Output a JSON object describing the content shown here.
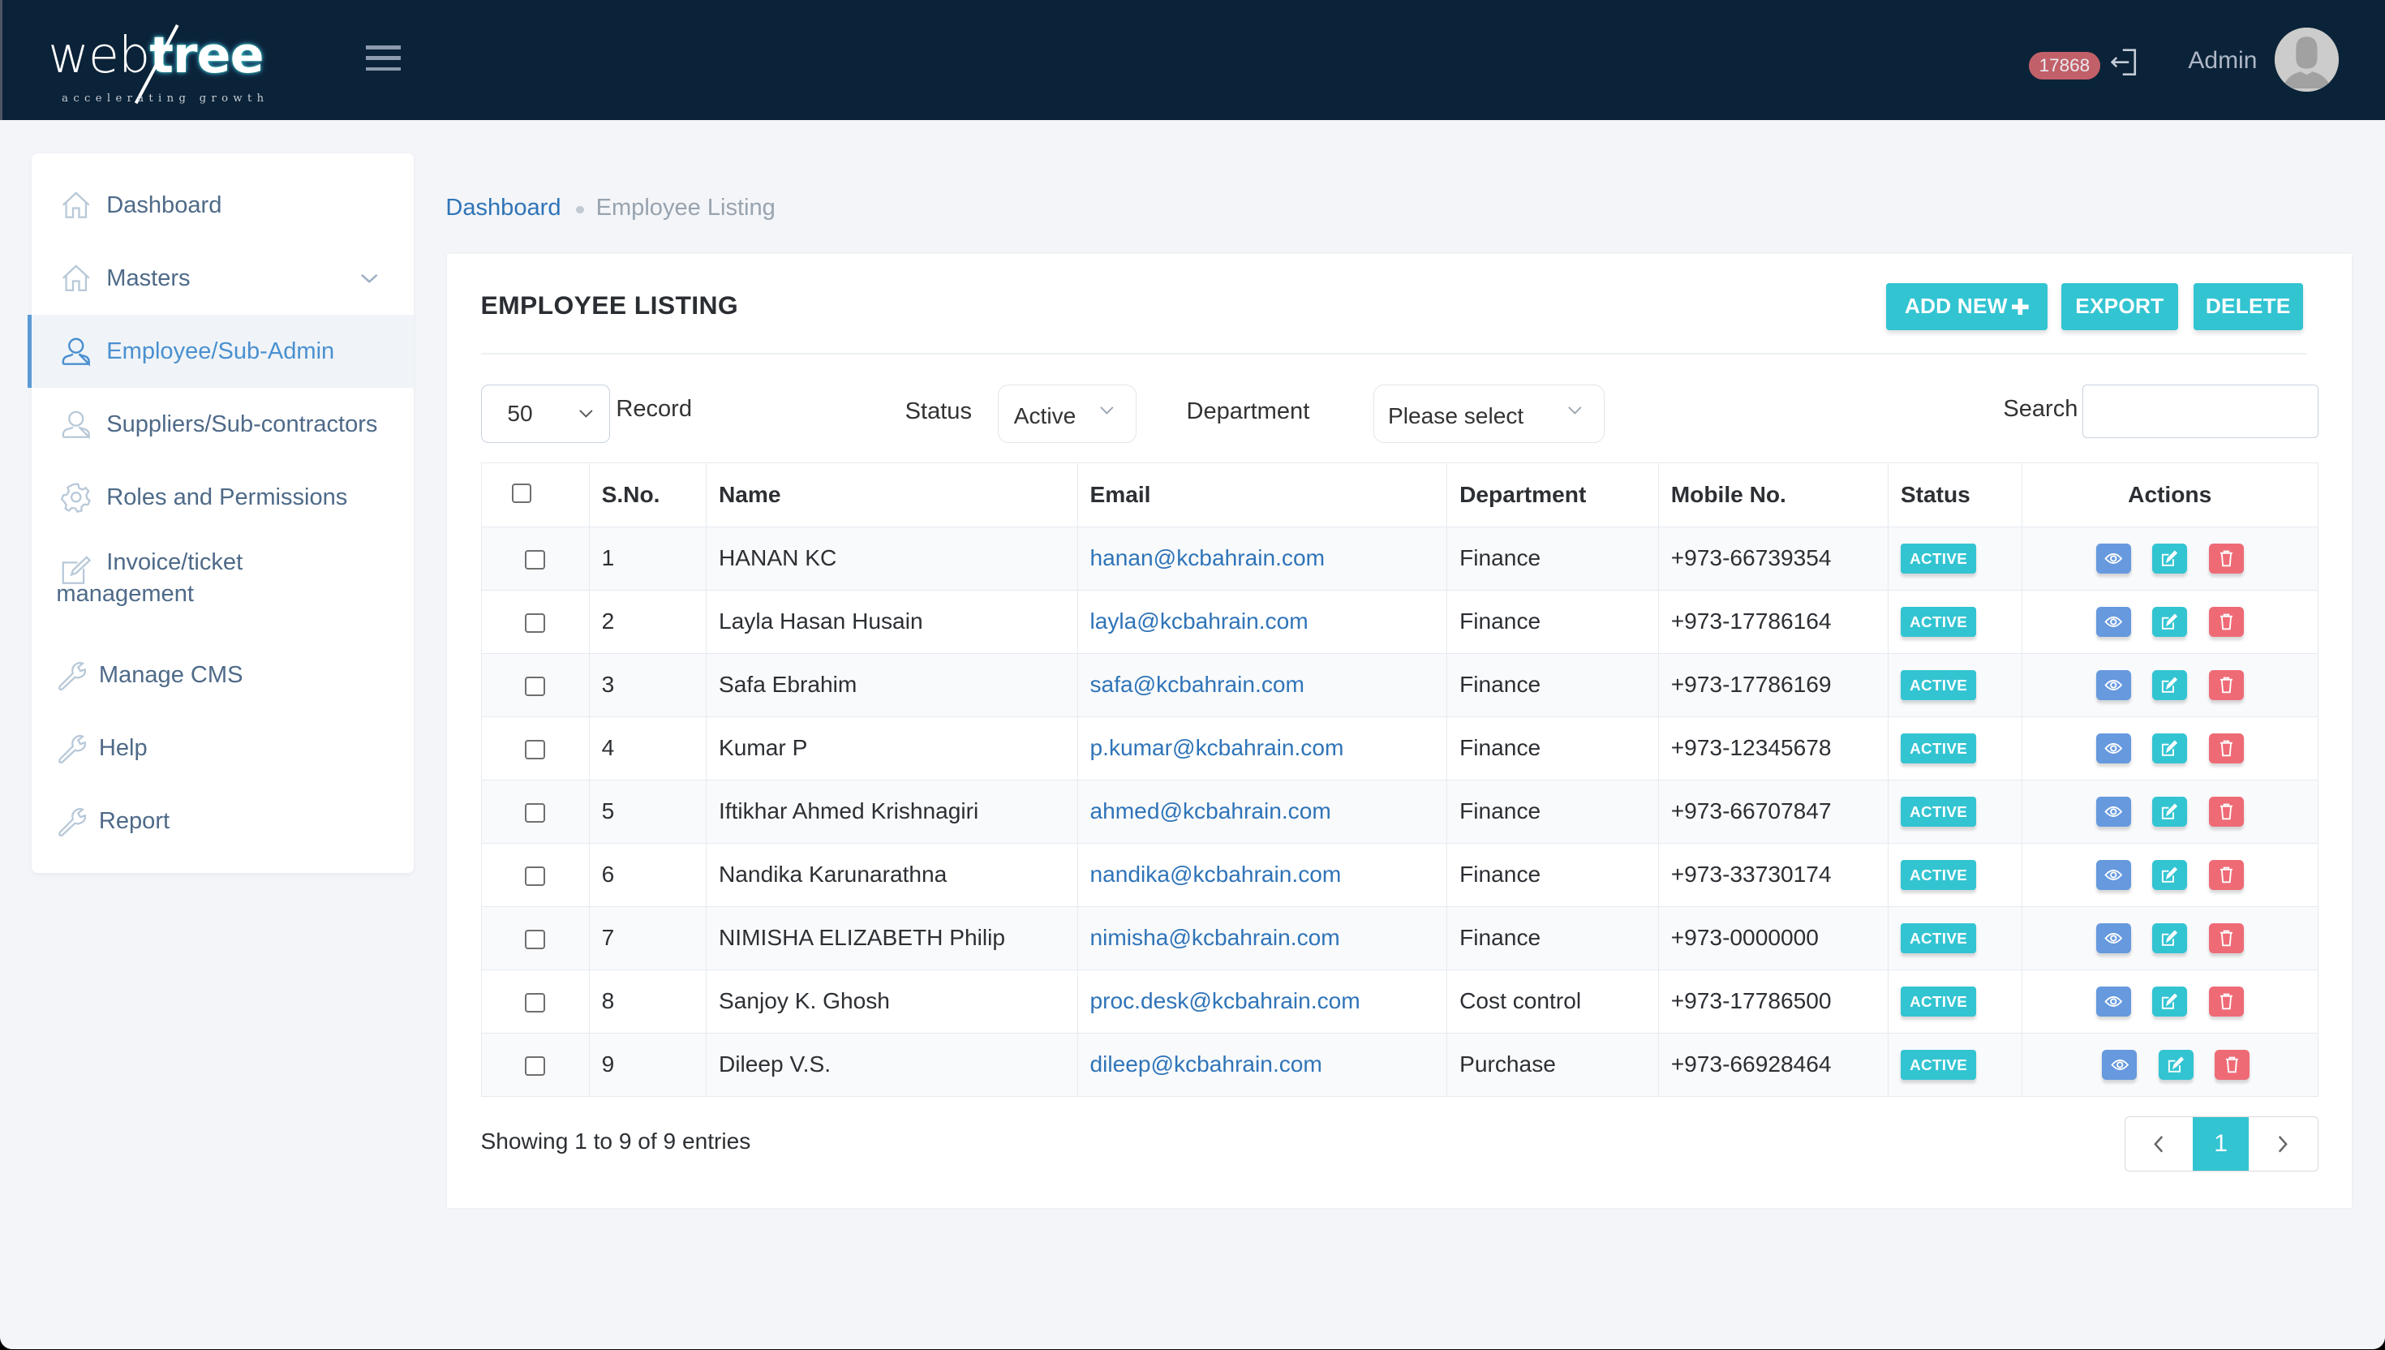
{
  "header": {
    "logo": {
      "word_a": "web",
      "word_b": "tree",
      "tagline": "accelerating growth"
    },
    "notification_count": "17868",
    "user_name": "Admin",
    "icons": {
      "menu": "hamburger-icon",
      "logout": "logout-icon",
      "avatar": "user-avatar-icon"
    }
  },
  "sidebar": {
    "items": [
      {
        "label": "Dashboard",
        "icon": "home-icon",
        "active": false
      },
      {
        "label": "Masters",
        "icon": "home-icon",
        "active": false,
        "has_submenu": true
      },
      {
        "label": "Employee/Sub-Admin",
        "icon": "user-icon",
        "active": true
      },
      {
        "label": "Suppliers/Sub-contractors",
        "icon": "user-icon",
        "active": false
      },
      {
        "label": "Roles and Permissions",
        "icon": "gear-icon",
        "active": false
      },
      {
        "label_line1": "Invoice/ticket",
        "label_line2": "management",
        "icon": "edit-icon",
        "active": false
      },
      {
        "label": "Manage CMS",
        "icon": "wrench-icon",
        "active": false
      },
      {
        "label": "Help",
        "icon": "wrench-icon",
        "active": false
      },
      {
        "label": "Report",
        "icon": "wrench-icon",
        "active": false
      }
    ]
  },
  "breadcrumb": {
    "home": "Dashboard",
    "current": "Employee Listing"
  },
  "card": {
    "title": "EMPLOYEE LISTING",
    "buttons": {
      "add_new": "ADD NEW",
      "export": "EXPORT",
      "delete": "DELETE"
    }
  },
  "filters": {
    "records_value": "50",
    "records_label": "Record",
    "status_label": "Status",
    "status_value": "Active",
    "department_label": "Department",
    "department_value": "Please select",
    "search_label": "Search",
    "search_value": ""
  },
  "table": {
    "columns": [
      "S.No.",
      "Name",
      "Email",
      "Department",
      "Mobile No.",
      "Status",
      "Actions"
    ],
    "rows": [
      {
        "sno": "1",
        "name": "HANAN KC",
        "email": "hanan@kcbahrain.com",
        "department": "Finance",
        "mobile": "+973-66739354",
        "status": "ACTIVE"
      },
      {
        "sno": "2",
        "name": "Layla Hasan Husain",
        "email": "layla@kcbahrain.com",
        "department": "Finance",
        "mobile": "+973-17786164",
        "status": "ACTIVE"
      },
      {
        "sno": "3",
        "name": "Safa Ebrahim",
        "email": "safa@kcbahrain.com",
        "department": "Finance",
        "mobile": "+973-17786169",
        "status": "ACTIVE"
      },
      {
        "sno": "4",
        "name": "Kumar P",
        "email": "p.kumar@kcbahrain.com",
        "department": "Finance",
        "mobile": "+973-12345678",
        "status": "ACTIVE"
      },
      {
        "sno": "5",
        "name": "Iftikhar Ahmed Krishnagiri",
        "email": "ahmed@kcbahrain.com",
        "department": "Finance",
        "mobile": "+973-66707847",
        "status": "ACTIVE"
      },
      {
        "sno": "6",
        "name": "Nandika Karunarathna",
        "email": "nandika@kcbahrain.com",
        "department": "Finance",
        "mobile": "+973-33730174",
        "status": "ACTIVE"
      },
      {
        "sno": "7",
        "name": "NIMISHA ELIZABETH Philip",
        "email": "nimisha@kcbahrain.com",
        "department": "Finance",
        "mobile": "+973-0000000",
        "status": "ACTIVE"
      },
      {
        "sno": "8",
        "name": "Sanjoy K. Ghosh",
        "email": "proc.desk@kcbahrain.com",
        "department": "Cost control",
        "mobile": "+973-17786500",
        "status": "ACTIVE"
      },
      {
        "sno": "9",
        "name": "Dileep V.S.",
        "email": "dileep@kcbahrain.com",
        "department": "Purchase",
        "mobile": "+973-66928464",
        "status": "ACTIVE"
      }
    ],
    "row_action_icons": [
      "eye-icon",
      "edit-icon",
      "trash-icon"
    ]
  },
  "footer": {
    "showing_text": "Showing 1 to 9 of 9 entries",
    "current_page": "1",
    "prev_symbol": "‹",
    "next_symbol": "›"
  },
  "colors": {
    "topbar": "#0b2338",
    "accent": "#33c4d2",
    "view_button": "#6699de",
    "delete_button": "#ee6b76",
    "badge": "#c2606a",
    "link": "#2f74b8",
    "active_nav": "#4a90d0"
  }
}
